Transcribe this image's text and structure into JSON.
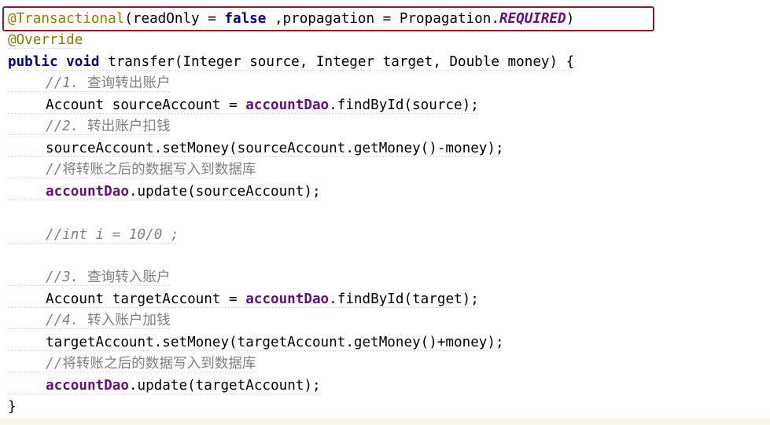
{
  "editor": {
    "lines": [
      {
        "tokens": [
          {
            "text": "@Transactional",
            "cls": "annotation"
          },
          {
            "text": "(readOnly = ",
            "cls": "normal"
          },
          {
            "text": "false",
            "cls": "keyword"
          },
          {
            "text": " ,propagation = Propagation.",
            "cls": "normal"
          },
          {
            "text": "REQUIRED",
            "cls": "static-field"
          },
          {
            "text": ")",
            "cls": "normal"
          }
        ]
      },
      {
        "tokens": [
          {
            "text": "@Override",
            "cls": "annotation"
          }
        ]
      },
      {
        "tokens": [
          {
            "text": "public",
            "cls": "keyword"
          },
          {
            "text": " ",
            "cls": "normal"
          },
          {
            "text": "void",
            "cls": "keyword"
          },
          {
            "text": " transfer(Integer source, Integer target, Double money) {",
            "cls": "normal"
          }
        ]
      },
      {
        "indent": true,
        "tokens": [
          {
            "text": "//1. ",
            "cls": "comment"
          },
          {
            "text": "查询转出账户",
            "cls": "comment comment-cjk"
          }
        ]
      },
      {
        "indent": true,
        "tokens": [
          {
            "text": "Account sourceAccount = ",
            "cls": "normal"
          },
          {
            "text": "accountDao",
            "cls": "field"
          },
          {
            "text": ".findById(source);",
            "cls": "normal"
          }
        ]
      },
      {
        "indent": true,
        "tokens": [
          {
            "text": "//2. ",
            "cls": "comment"
          },
          {
            "text": "转出账户扣钱",
            "cls": "comment comment-cjk"
          }
        ]
      },
      {
        "indent": true,
        "tokens": [
          {
            "text": "sourceAccount.setMoney(sourceAccount.getMoney()-money);",
            "cls": "normal"
          }
        ]
      },
      {
        "indent": true,
        "tokens": [
          {
            "text": "//",
            "cls": "comment"
          },
          {
            "text": "将转账之后的数据写入到数据库",
            "cls": "comment comment-cjk"
          }
        ]
      },
      {
        "indent": true,
        "tokens": [
          {
            "text": "accountDao",
            "cls": "field"
          },
          {
            "text": ".update(sourceAccount);",
            "cls": "normal"
          }
        ]
      },
      {
        "indent": true,
        "blank": true,
        "tokens": []
      },
      {
        "indent": true,
        "tokens": [
          {
            "text": "//int i = 10/0 ;",
            "cls": "comment"
          }
        ]
      },
      {
        "indent": true,
        "blank": true,
        "tokens": []
      },
      {
        "indent": true,
        "tokens": [
          {
            "text": "//3. ",
            "cls": "comment"
          },
          {
            "text": "查询转入账户",
            "cls": "comment comment-cjk"
          }
        ]
      },
      {
        "indent": true,
        "tokens": [
          {
            "text": "Account targetAccount = ",
            "cls": "normal"
          },
          {
            "text": "accountDao",
            "cls": "field"
          },
          {
            "text": ".findById(target);",
            "cls": "normal"
          }
        ]
      },
      {
        "indent": true,
        "tokens": [
          {
            "text": "//4. ",
            "cls": "comment"
          },
          {
            "text": "转入账户加钱",
            "cls": "comment comment-cjk"
          }
        ]
      },
      {
        "indent": true,
        "tokens": [
          {
            "text": "targetAccount.setMoney(targetAccount.getMoney()+money);",
            "cls": "normal"
          }
        ]
      },
      {
        "indent": true,
        "tokens": [
          {
            "text": "//",
            "cls": "comment"
          },
          {
            "text": "将转账之后的数据写入到数据库",
            "cls": "comment comment-cjk"
          }
        ]
      },
      {
        "indent": true,
        "tokens": [
          {
            "text": "accountDao",
            "cls": "field"
          },
          {
            "text": ".update(targetAccount);",
            "cls": "normal"
          }
        ]
      },
      {
        "plain": true,
        "tokens": [
          {
            "text": "}",
            "cls": "normal"
          }
        ]
      }
    ],
    "colors": {
      "annotation": "#808000",
      "keyword": "#000080",
      "field": "#660e7a",
      "comment": "#808080",
      "highlight_border": "#8b1a2b"
    }
  }
}
